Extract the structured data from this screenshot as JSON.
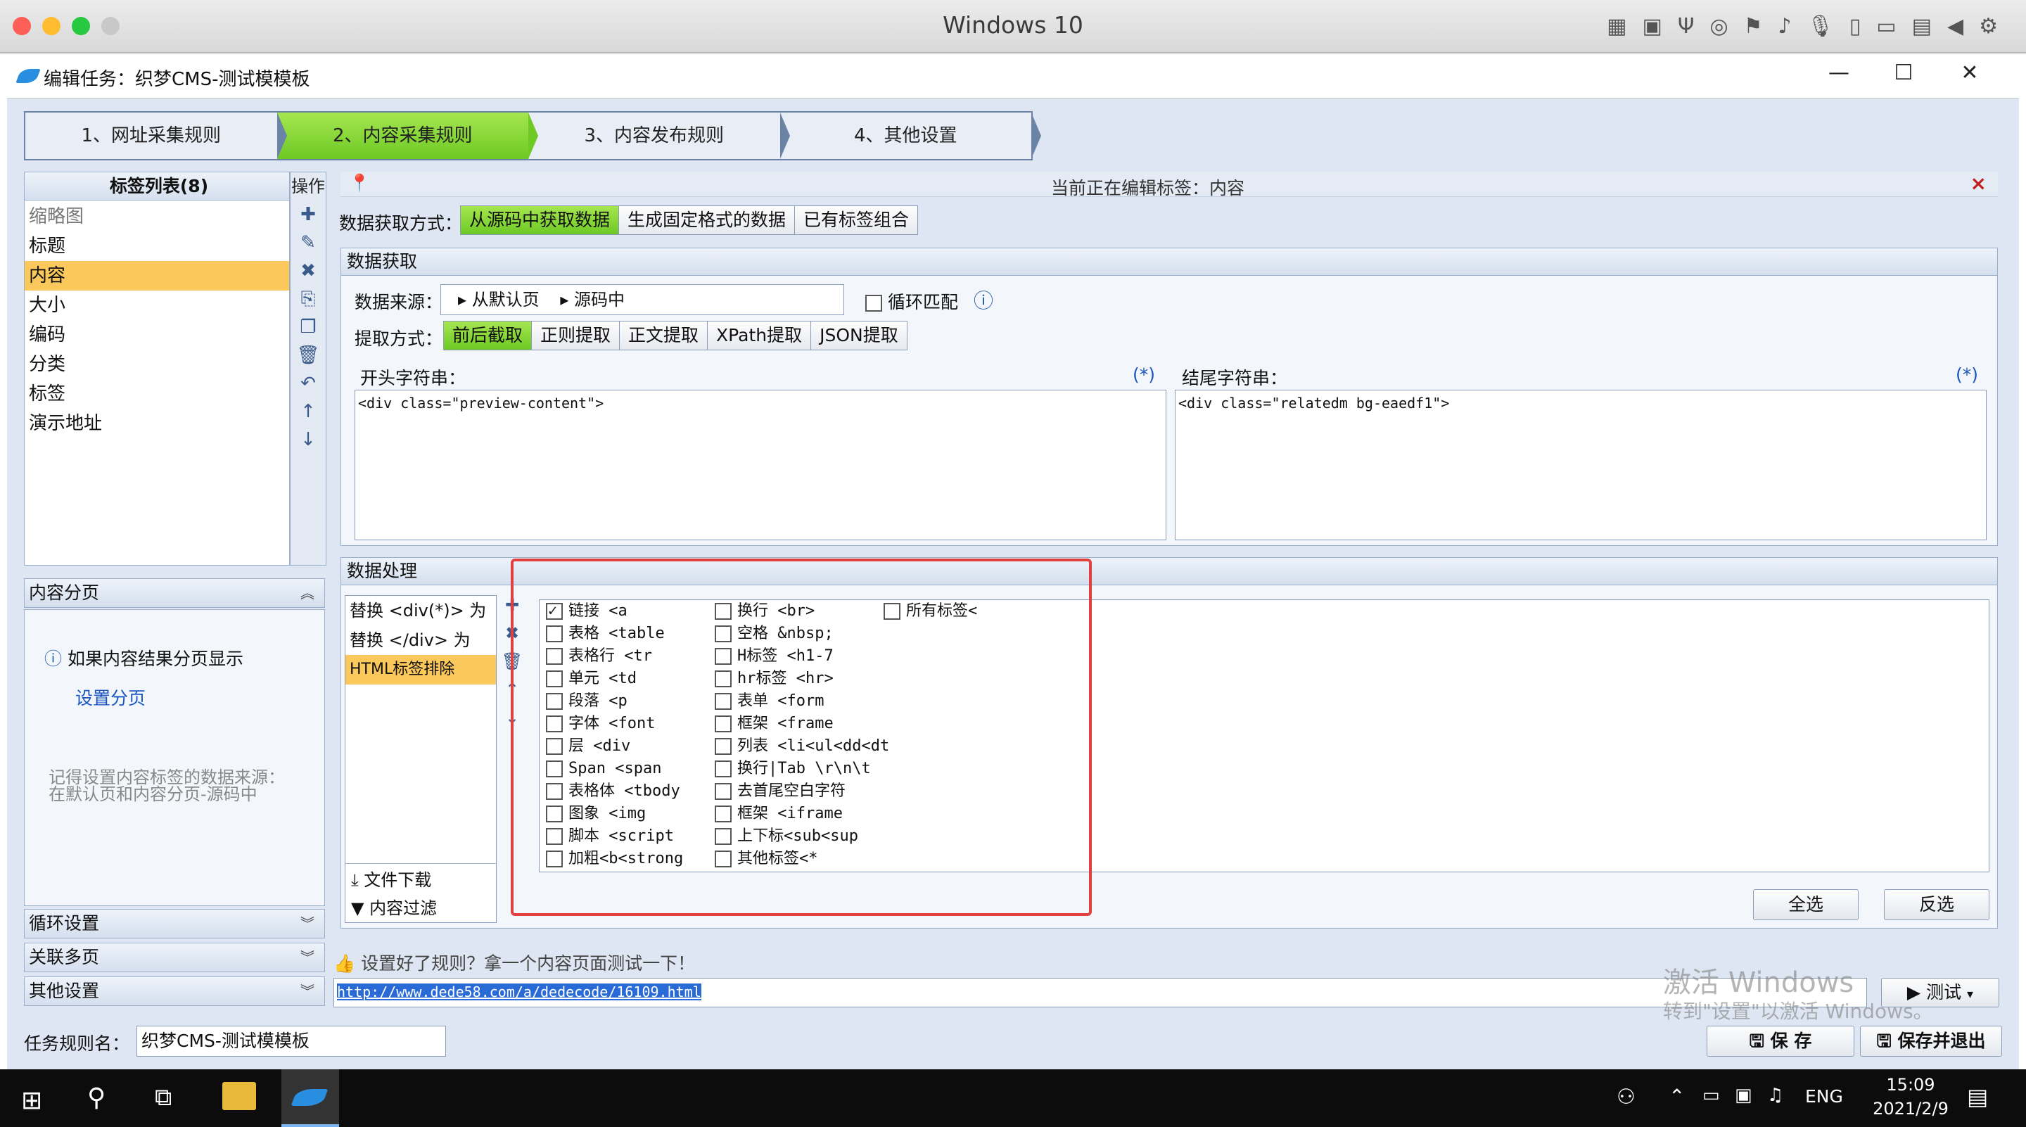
{
  "mac": {
    "title": "Windows 10",
    "icons": [
      "grid-icon",
      "chip-icon",
      "usb-icon",
      "disc-icon",
      "flag-icon",
      "speaker-icon",
      "mic-icon",
      "phone-icon",
      "camera-icon",
      "folder-icon",
      "back-icon",
      "gear-icon"
    ]
  },
  "window": {
    "title": "编辑任务：织梦CMS-测试模模板",
    "min": "—",
    "max": "☐",
    "close": "✕"
  },
  "wizard": {
    "steps": [
      "1、网址采集规则",
      "2、内容采集规则",
      "3、内容发布规则",
      "4、其他设置"
    ],
    "active": 1
  },
  "tags": {
    "header": "标签列表(8)",
    "ops_header": "操作",
    "items": [
      "缩略图",
      "标题",
      "内容",
      "大小",
      "编码",
      "分类",
      "标签",
      "演示地址"
    ],
    "selected": 2
  },
  "paging": {
    "header": "内容分页",
    "hint": "如果内容结果分页显示",
    "link": "设置分页",
    "note1": "记得设置内容标签的数据来源：",
    "note2": "在默认页和内容分页-源码中"
  },
  "accordion": {
    "loop": "循环设置",
    "multi": "关联多页",
    "other": "其他设置"
  },
  "editing": {
    "label": "当前正在编辑标签：内容",
    "close": "×"
  },
  "acquire": {
    "label": "数据获取方式：",
    "options": [
      "从源码中获取数据",
      "生成固定格式的数据",
      "已有标签组合"
    ],
    "active": 0
  },
  "datafetch": {
    "header": "数据获取",
    "source_label": "数据来源：",
    "source_parts": [
      "从默认页",
      "源码中"
    ],
    "loop_match": "循环匹配",
    "extract_label": "提取方式：",
    "extract_options": [
      "前后截取",
      "正则提取",
      "正文提取",
      "XPath提取",
      "JSON提取"
    ],
    "extract_active": 0,
    "start_label": "开头字符串：",
    "start_value": "<div class=\"preview-content\">",
    "end_label": "结尾字符串：",
    "end_value": "<div class=\"relatedm bg-eaedf1\">",
    "star": "(*)"
  },
  "processing": {
    "header": "数据处理",
    "rules": [
      "替换 <div(*)> 为",
      "替换 </div> 为",
      "HTML标签排除"
    ],
    "rule_selected": 2,
    "download": "文件下载",
    "filter": "内容过滤",
    "col1": [
      [
        "链接 <a",
        true
      ],
      [
        "表格 <table",
        false
      ],
      [
        "表格行 <tr",
        false
      ],
      [
        "单元 <td",
        false
      ],
      [
        "段落 <p",
        false
      ],
      [
        "字体 <font",
        false
      ],
      [
        "层 <div",
        false
      ],
      [
        "Span <span",
        false
      ],
      [
        "表格体 <tbody",
        false
      ],
      [
        "图象 <img",
        false
      ],
      [
        "脚本 <script",
        false
      ],
      [
        "加粗<b<strong",
        false
      ]
    ],
    "col2": [
      [
        "换行 <br>",
        false
      ],
      [
        "空格 &nbsp;",
        false
      ],
      [
        "H标签 <h1-7",
        false
      ],
      [
        "hr标签 <hr>",
        false
      ],
      [
        "表单 <form",
        false
      ],
      [
        "框架 <frame",
        false
      ],
      [
        "列表 <li<ul<dd<dt",
        false
      ],
      [
        "换行|Tab \\r\\n\\t",
        false
      ],
      [
        "去首尾空白字符",
        false
      ],
      [
        "框架 <iframe",
        false
      ],
      [
        "上下标<sub<sup",
        false
      ],
      [
        "其他标签<*",
        false
      ]
    ],
    "col3": [
      [
        "所有标签<",
        false
      ]
    ],
    "select_all": "全选",
    "invert": "反选"
  },
  "test": {
    "hint": "设置好了规则？拿一个内容页面测试一下！",
    "url": "http://www.dede58.com/a/dedecode/16109.html",
    "button": "测试"
  },
  "watermark": {
    "line1": "激活 Windows",
    "line2": "转到\"设置\"以激活 Windows。"
  },
  "bottom": {
    "name_label": "任务规则名：",
    "name_value": "织梦CMS-测试模模板",
    "save": "保 存",
    "save_exit": "保存并退出"
  },
  "taskbar": {
    "lang": "ENG",
    "time": "15:09",
    "date": "2021/2/9"
  },
  "colors": {
    "accent_green": "#6dc924",
    "selected": "#fbc85b",
    "highlight": "#e04040"
  }
}
